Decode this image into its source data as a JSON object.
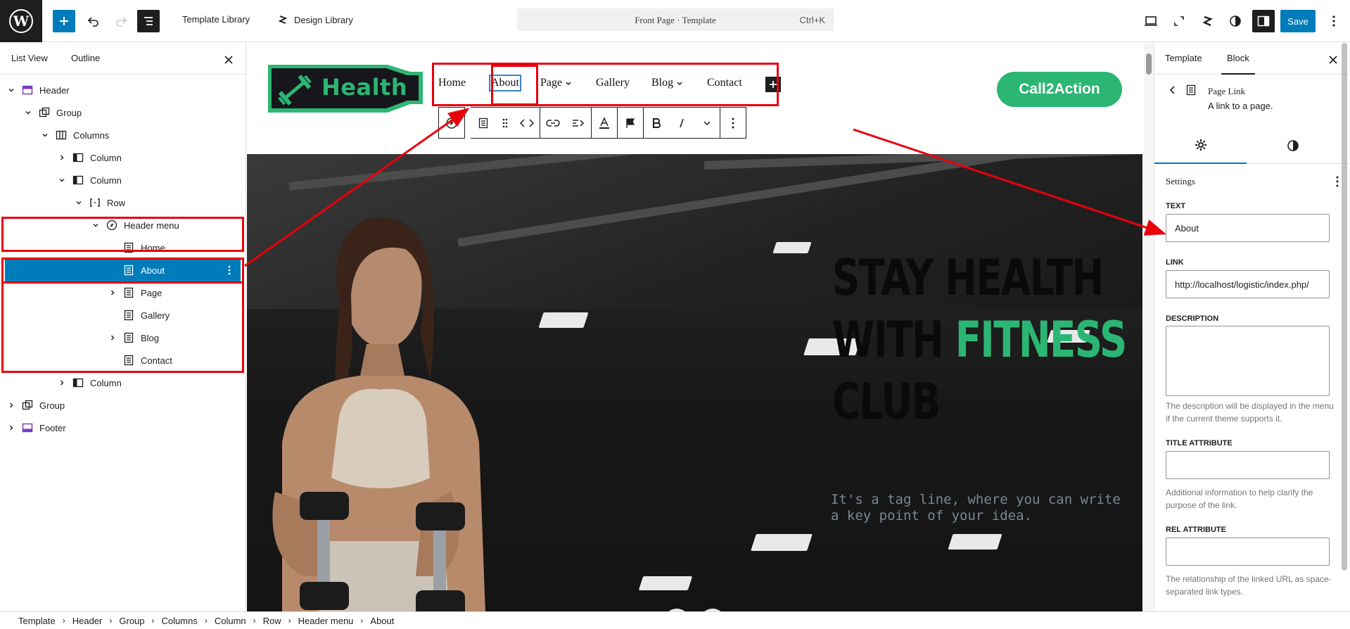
{
  "topbar": {
    "template_library": "Template Library",
    "design_library": "Design Library",
    "command_title": "Front Page · Template",
    "command_shortcut": "Ctrl+K",
    "save": "Save"
  },
  "left_panel": {
    "tabs": [
      "List View",
      "Outline"
    ],
    "tree": [
      {
        "label": "Header"
      },
      {
        "label": "Group"
      },
      {
        "label": "Columns"
      },
      {
        "label": "Column"
      },
      {
        "label": "Column"
      },
      {
        "label": "Row"
      },
      {
        "label": "Header menu"
      },
      {
        "label": "Home"
      },
      {
        "label": "About"
      },
      {
        "label": "Page"
      },
      {
        "label": "Gallery"
      },
      {
        "label": "Blog"
      },
      {
        "label": "Contact"
      },
      {
        "label": "Column"
      },
      {
        "label": "Group"
      },
      {
        "label": "Footer"
      }
    ]
  },
  "canvas": {
    "logo_text": "Health",
    "nav": [
      "Home",
      "About",
      "Page",
      "Gallery",
      "Blog",
      "Contact"
    ],
    "cta": "Call2Action",
    "hero": {
      "line1": "STAY HEALTH",
      "line2_a": "WITH ",
      "line2_b": "FITNESS",
      "line3": "CLUB",
      "tagline": "It's a tag line, where you can write a key point of your idea."
    }
  },
  "right_panel": {
    "tabs": [
      "Template",
      "Block"
    ],
    "block_title": "Page Link",
    "block_desc": "A link to a page.",
    "settings_title": "Settings",
    "fields": {
      "text_label": "TEXT",
      "text_value": "About",
      "link_label": "LINK",
      "link_value": "http://localhost/logistic/index.php/",
      "description_label": "DESCRIPTION",
      "description_help": "The description will be displayed in the menu if the current theme supports it.",
      "title_attr_label": "TITLE ATTRIBUTE",
      "title_attr_help": "Additional information to help clarify the purpose of the link.",
      "rel_attr_label": "REL ATTRIBUTE",
      "rel_attr_help": "The relationship of the linked URL as space-separated link types."
    }
  },
  "breadcrumb": [
    "Template",
    "Header",
    "Group",
    "Columns",
    "Column",
    "Row",
    "Header menu",
    "About"
  ],
  "colors": {
    "wp_blue": "#007cba",
    "accent_green": "#2bb673",
    "annotation_red": "#e8000b"
  }
}
